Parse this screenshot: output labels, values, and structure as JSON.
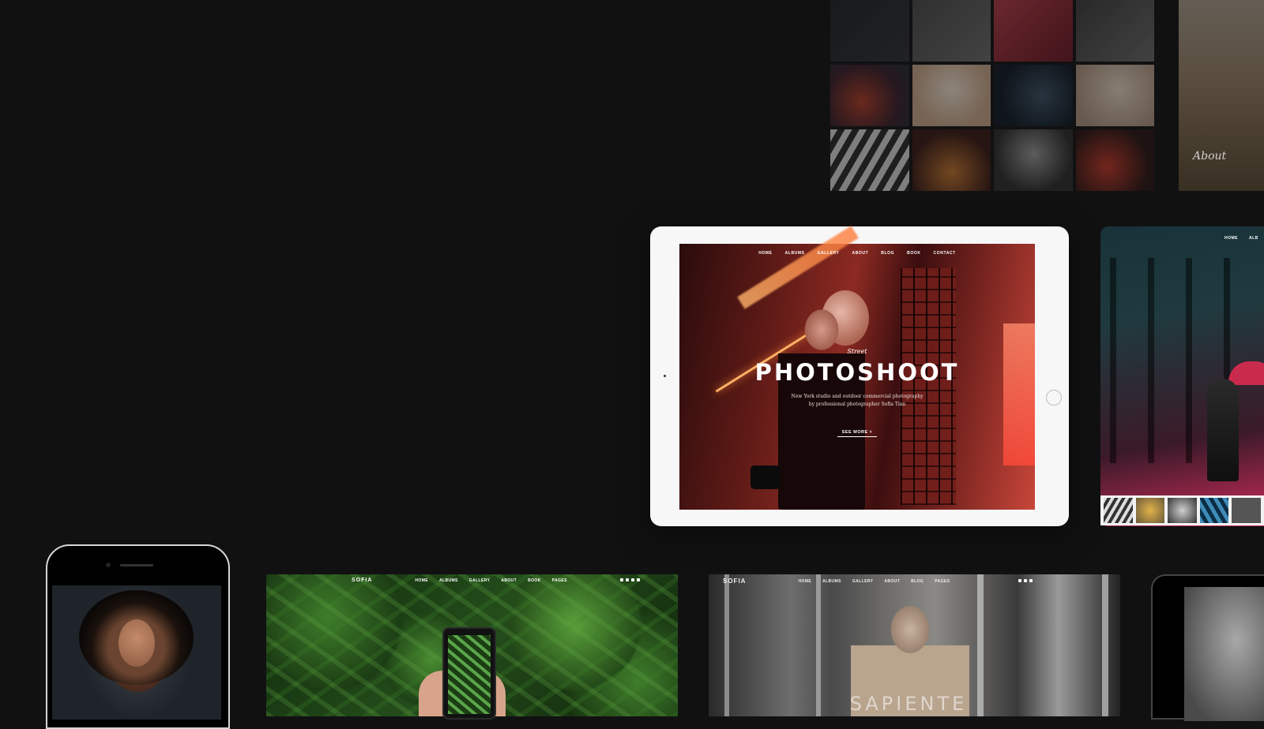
{
  "top_gallery": {
    "about_label": "About"
  },
  "ipad": {
    "nav": [
      "HOME",
      "ALBUMS",
      "GALLERY",
      "ABOUT",
      "BLOG",
      "BOOK",
      "CONTACT"
    ],
    "subtitle": "Street",
    "title": "PHOTOSHOOT",
    "desc_line1": "New York studio and outdoor commercial photography",
    "desc_line2": "by professional photographer Sofia Tian",
    "see_more": "SEE MORE ˅"
  },
  "right_screen": {
    "nav": [
      "HOME",
      "ALB"
    ]
  },
  "card_green": {
    "logo": "SOFIA",
    "nav": [
      "HOME",
      "ALBUMS",
      "GALLERY",
      "ABOUT",
      "BOOK",
      "PAGES"
    ]
  },
  "card_gray": {
    "logo": "SOFIA",
    "nav": [
      "HOME",
      "ALBUMS",
      "GALLERY",
      "ABOUT",
      "BLOG",
      "PAGES"
    ],
    "headline": "SAPIENTE"
  }
}
